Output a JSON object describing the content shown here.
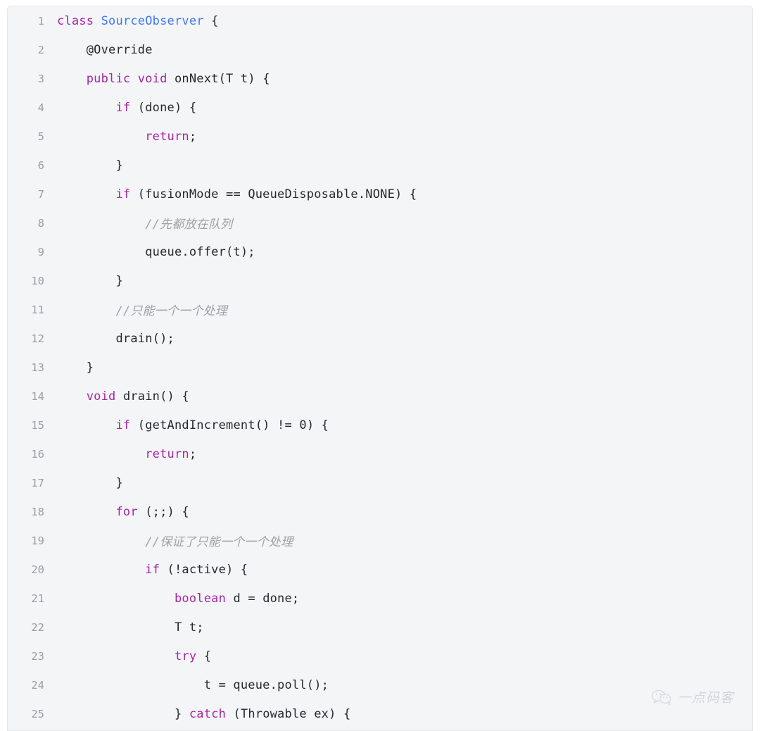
{
  "card": {
    "background_color": "#f4f5f7",
    "border_color": "#e6e8ec",
    "gutter_color": "#9b9ea5"
  },
  "syntax_colors": {
    "keyword": "#a626a4",
    "type": "#4078f2",
    "function": "#4078f2",
    "annotation": "#4078f2",
    "number": "#c18401",
    "plain": "#24292e",
    "comment": "#a0a1a7"
  },
  "code": {
    "language": "java",
    "lines": [
      {
        "number": "1",
        "tokens": [
          {
            "t": "class",
            "c": "keyword"
          },
          {
            "t": " ",
            "c": "plain"
          },
          {
            "t": "SourceObserver",
            "c": "type"
          },
          {
            "t": " {",
            "c": "plain"
          }
        ]
      },
      {
        "number": "2",
        "tokens": [
          {
            "t": "    ",
            "c": "plain"
          },
          {
            "t": "@Override",
            "c": "annotation"
          }
        ]
      },
      {
        "number": "3",
        "tokens": [
          {
            "t": "    ",
            "c": "plain"
          },
          {
            "t": "public",
            "c": "keyword"
          },
          {
            "t": " ",
            "c": "plain"
          },
          {
            "t": "void",
            "c": "keyword"
          },
          {
            "t": " ",
            "c": "plain"
          },
          {
            "t": "onNext",
            "c": "function"
          },
          {
            "t": "(T t) {",
            "c": "plain"
          }
        ]
      },
      {
        "number": "4",
        "tokens": [
          {
            "t": "        ",
            "c": "plain"
          },
          {
            "t": "if",
            "c": "keyword"
          },
          {
            "t": " (done) {",
            "c": "plain"
          }
        ]
      },
      {
        "number": "5",
        "tokens": [
          {
            "t": "            ",
            "c": "plain"
          },
          {
            "t": "return",
            "c": "keyword"
          },
          {
            "t": ";",
            "c": "plain"
          }
        ]
      },
      {
        "number": "6",
        "tokens": [
          {
            "t": "        }",
            "c": "plain"
          }
        ]
      },
      {
        "number": "7",
        "tokens": [
          {
            "t": "        ",
            "c": "plain"
          },
          {
            "t": "if",
            "c": "keyword"
          },
          {
            "t": " (fusionMode == QueueDisposable.NONE) {",
            "c": "plain"
          }
        ]
      },
      {
        "number": "8",
        "tokens": [
          {
            "t": "            ",
            "c": "plain"
          },
          {
            "t": "//先都放在队列",
            "c": "comment"
          }
        ]
      },
      {
        "number": "9",
        "tokens": [
          {
            "t": "            queue.offer(t);",
            "c": "plain"
          }
        ]
      },
      {
        "number": "10",
        "tokens": [
          {
            "t": "        }",
            "c": "plain"
          }
        ]
      },
      {
        "number": "11",
        "tokens": [
          {
            "t": "        ",
            "c": "plain"
          },
          {
            "t": "//只能一个一个处理",
            "c": "comment"
          }
        ]
      },
      {
        "number": "12",
        "tokens": [
          {
            "t": "        drain();",
            "c": "plain"
          }
        ]
      },
      {
        "number": "13",
        "tokens": [
          {
            "t": "    }",
            "c": "plain"
          }
        ]
      },
      {
        "number": "14",
        "tokens": [
          {
            "t": "    ",
            "c": "plain"
          },
          {
            "t": "void",
            "c": "keyword"
          },
          {
            "t": " ",
            "c": "plain"
          },
          {
            "t": "drain",
            "c": "function"
          },
          {
            "t": "() {",
            "c": "plain"
          }
        ]
      },
      {
        "number": "15",
        "tokens": [
          {
            "t": "        ",
            "c": "plain"
          },
          {
            "t": "if",
            "c": "keyword"
          },
          {
            "t": " (getAndIncrement() != ",
            "c": "plain"
          },
          {
            "t": "0",
            "c": "number"
          },
          {
            "t": ") {",
            "c": "plain"
          }
        ]
      },
      {
        "number": "16",
        "tokens": [
          {
            "t": "            ",
            "c": "plain"
          },
          {
            "t": "return",
            "c": "keyword"
          },
          {
            "t": ";",
            "c": "plain"
          }
        ]
      },
      {
        "number": "17",
        "tokens": [
          {
            "t": "        }",
            "c": "plain"
          }
        ]
      },
      {
        "number": "18",
        "tokens": [
          {
            "t": "        ",
            "c": "plain"
          },
          {
            "t": "for",
            "c": "keyword"
          },
          {
            "t": " (;;) {",
            "c": "plain"
          }
        ]
      },
      {
        "number": "19",
        "tokens": [
          {
            "t": "            ",
            "c": "plain"
          },
          {
            "t": "//保证了只能一个一个处理",
            "c": "comment"
          }
        ]
      },
      {
        "number": "20",
        "tokens": [
          {
            "t": "            ",
            "c": "plain"
          },
          {
            "t": "if",
            "c": "keyword"
          },
          {
            "t": " (!active) {",
            "c": "plain"
          }
        ]
      },
      {
        "number": "21",
        "tokens": [
          {
            "t": "                ",
            "c": "plain"
          },
          {
            "t": "boolean",
            "c": "keyword"
          },
          {
            "t": " d = done;",
            "c": "plain"
          }
        ]
      },
      {
        "number": "22",
        "tokens": [
          {
            "t": "                T t;",
            "c": "plain"
          }
        ]
      },
      {
        "number": "23",
        "tokens": [
          {
            "t": "                ",
            "c": "plain"
          },
          {
            "t": "try",
            "c": "keyword"
          },
          {
            "t": " {",
            "c": "plain"
          }
        ]
      },
      {
        "number": "24",
        "tokens": [
          {
            "t": "                    t = queue.poll();",
            "c": "plain"
          }
        ]
      },
      {
        "number": "25",
        "tokens": [
          {
            "t": "                } ",
            "c": "plain"
          },
          {
            "t": "catch",
            "c": "keyword"
          },
          {
            "t": " (Throwable ex) {",
            "c": "plain"
          }
        ]
      }
    ]
  },
  "watermark": {
    "icon": "wechat-logo-icon",
    "text": "一点码客",
    "color": "#b9bcc2"
  }
}
